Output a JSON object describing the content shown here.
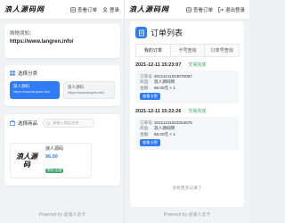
{
  "brand": {
    "logo_text": "浪人源码网"
  },
  "topbar": {
    "orders_label": "查看订单",
    "login_label": "登录",
    "logout_label": "退出登录"
  },
  "left": {
    "url_label": "购物须知：",
    "url_value": "https://www.langren.info/",
    "category_title": "选择分类",
    "categories": [
      {
        "name": "浪人源码",
        "sub": "https://www.langren.info/"
      },
      {
        "name": "浪人源码",
        "sub": "https://www.langren.info/"
      }
    ],
    "products_title": "选择商品",
    "search_placeholder": "请输入商品名称",
    "product": {
      "image_text": "浪人源码",
      "name": "浪人源码",
      "price": "¥6.00",
      "stock": "库存:无限"
    },
    "footer": "Powered by @浪人云卡"
  },
  "right": {
    "title": "订单列表",
    "tabs": [
      "我的订单",
      "卡号查询",
      "订单号查询"
    ],
    "orders": [
      {
        "time": "2021-12-11 15:23:07",
        "status": "交易完成",
        "order_no_label": "订单号:",
        "order_no": "20211211023075087",
        "product_label": "商品:",
        "product": "浪人源码网",
        "amount_label": "金额:",
        "amount": "66.00元 × 1",
        "btn": "查看卡密"
      },
      {
        "time": "2021-12-11 15:22:26",
        "status": "交易完成",
        "order_no_label": "订单号:",
        "order_no": "20211211022254575",
        "product_label": "商品:",
        "product": "浪人源码网",
        "amount_label": "金额:",
        "amount": "66.00元 × 1",
        "btn": "查看卡密"
      }
    ],
    "no_more": "没有更多记录了",
    "footer": "Powered by @浪人云卡"
  },
  "colors": {
    "accent": "#2f7cf6",
    "success": "#3ea86a"
  }
}
